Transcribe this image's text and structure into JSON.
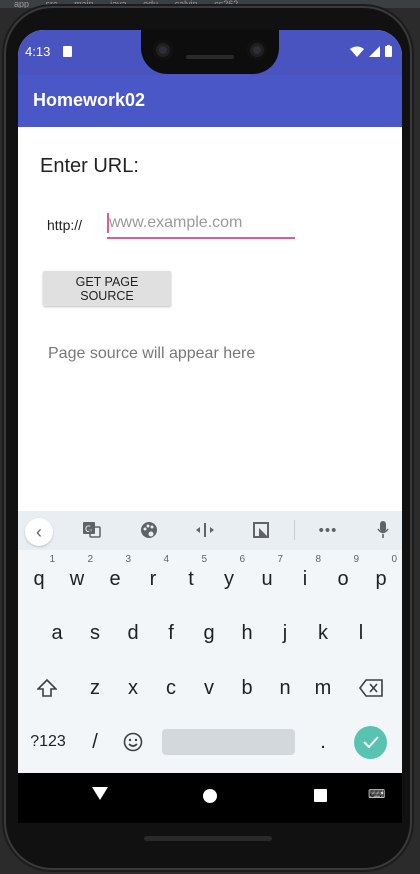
{
  "ide_tabs": [
    "app",
    "src",
    "main",
    "java",
    "edu",
    "calvin",
    "cs262"
  ],
  "status_bar": {
    "time": "4:13"
  },
  "app": {
    "title": "Homework02"
  },
  "form": {
    "heading": "Enter URL:",
    "protocol_label": "http://",
    "url_input": {
      "value": "",
      "placeholder": "www.example.com"
    },
    "button_label": "GET PAGE SOURCE",
    "output_text": "Page source will appear here"
  },
  "keyboard": {
    "row1": [
      {
        "k": "q",
        "h": "1"
      },
      {
        "k": "w",
        "h": "2"
      },
      {
        "k": "e",
        "h": "3"
      },
      {
        "k": "r",
        "h": "4"
      },
      {
        "k": "t",
        "h": "5"
      },
      {
        "k": "y",
        "h": "6"
      },
      {
        "k": "u",
        "h": "7"
      },
      {
        "k": "i",
        "h": "8"
      },
      {
        "k": "o",
        "h": "9"
      },
      {
        "k": "p",
        "h": "0"
      }
    ],
    "row2": [
      "a",
      "s",
      "d",
      "f",
      "g",
      "h",
      "j",
      "k",
      "l"
    ],
    "row3": [
      "z",
      "x",
      "c",
      "v",
      "b",
      "n",
      "m"
    ],
    "symbols_label": "?123",
    "slash": "/",
    "period": "."
  },
  "colors": {
    "toolbar": "#4a57c7",
    "accent": "#e05b93",
    "enter": "#57c3b0"
  }
}
